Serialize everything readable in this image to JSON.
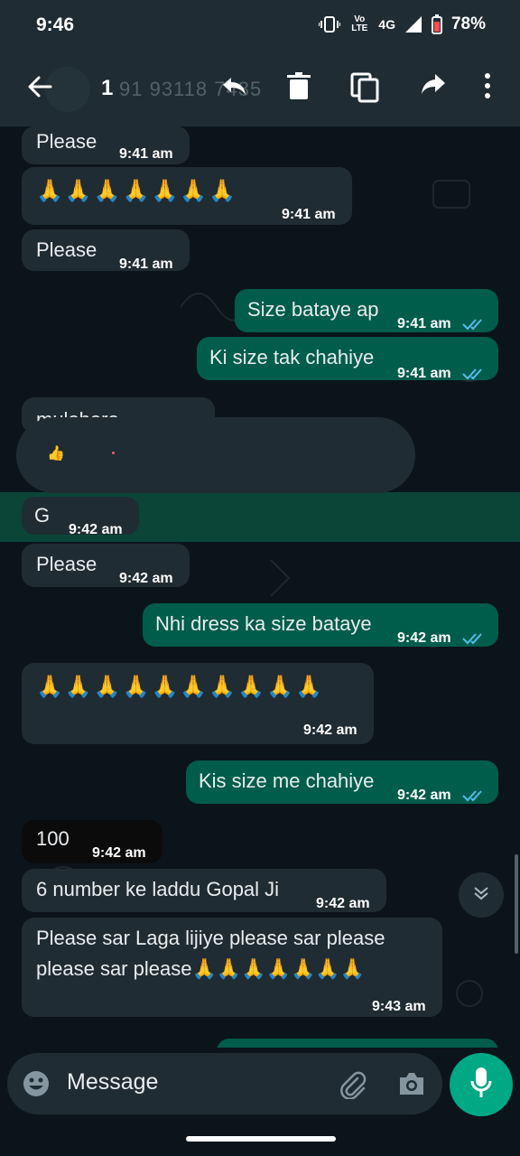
{
  "status_bar": {
    "time": "9:46",
    "network": "4G",
    "volte": "Vo LTE",
    "battery": "78%"
  },
  "header": {
    "selected_count": "1",
    "contact_number": "91 93118 7435",
    "actions": [
      "reply-icon",
      "delete-icon",
      "copy-icon",
      "forward-icon",
      "more-icon"
    ]
  },
  "messages": [
    {
      "dir": "in",
      "text": "Please",
      "time": "9:41 am"
    },
    {
      "dir": "in",
      "text": "🙏🙏🙏🙏🙏🙏🙏",
      "time": "9:41 am"
    },
    {
      "dir": "in",
      "text": "Please",
      "time": "9:41 am"
    },
    {
      "dir": "out",
      "text": "Size bataye ap",
      "time": "9:41 am"
    },
    {
      "dir": "out",
      "text": "Ki size tak chahiye",
      "time": "9:41 am"
    },
    {
      "dir": "in",
      "text": "mulohoro",
      "time": ""
    },
    {
      "dir": "in",
      "text": "👍",
      "time": ""
    },
    {
      "dir": "in",
      "text": "G",
      "time": "9:42 am"
    },
    {
      "dir": "in",
      "text": "Please",
      "time": "9:42 am"
    },
    {
      "dir": "out",
      "text": "Nhi dress ka size bataye",
      "time": "9:42 am"
    },
    {
      "dir": "in",
      "text": "🙏🙏🙏🙏🙏🙏🙏🙏🙏🙏",
      "time": "9:42 am"
    },
    {
      "dir": "out",
      "text": "Kis size me chahiye",
      "time": "9:42 am"
    },
    {
      "dir": "in",
      "text": "100",
      "time": "9:42 am"
    },
    {
      "dir": "in",
      "text": "6 number ke laddu Gopal Ji",
      "time": "9:42 am"
    },
    {
      "dir": "in",
      "text_line1": "Please sar Laga lijiye please sar please",
      "text_line2": "please sar please🙏🙏🙏🙏🙏🙏🙏",
      "time": "9:43 am"
    }
  ],
  "composer": {
    "placeholder": "Message"
  },
  "colors": {
    "background": "#0b141a",
    "incoming_bubble": "#202c33",
    "outgoing_bubble": "#005c4b",
    "accent": "#00a884",
    "read_ticks": "#53bdeb"
  }
}
